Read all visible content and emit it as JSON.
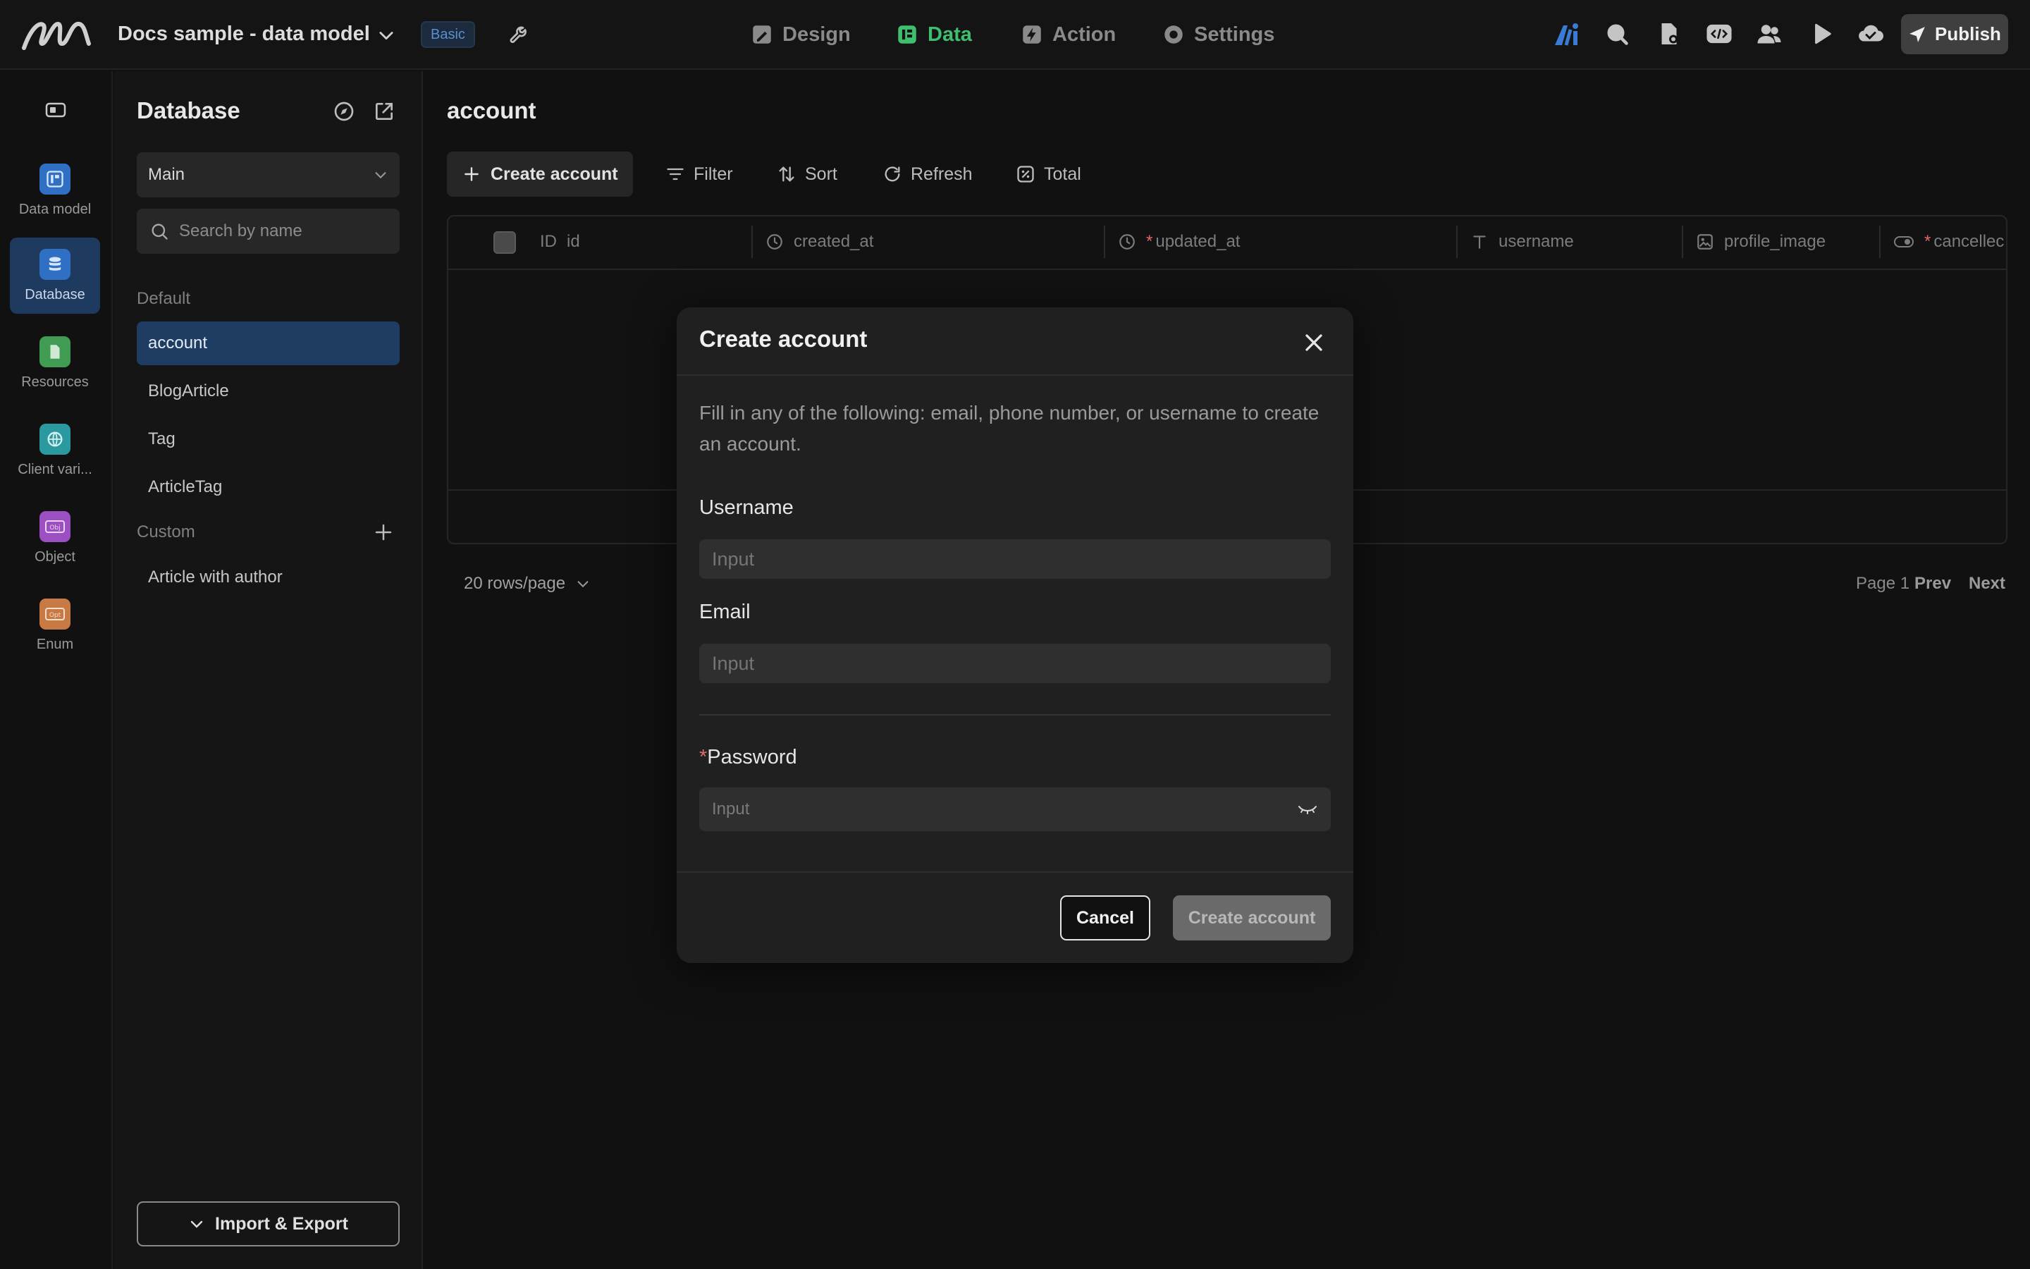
{
  "header": {
    "project_name": "Docs sample - data model",
    "plan_badge": "Basic",
    "tabs": [
      {
        "label": "Design",
        "icon": "pen-ruler-icon"
      },
      {
        "label": "Data",
        "icon": "table-icon"
      },
      {
        "label": "Action",
        "icon": "lightning-icon"
      },
      {
        "label": "Settings",
        "icon": "gear-icon"
      }
    ],
    "active_tab": "Data",
    "publish_label": "Publish"
  },
  "rail": {
    "items": [
      {
        "label": "Data model",
        "icon": "data-model-icon",
        "color": "#3b82f6"
      },
      {
        "label": "Database",
        "icon": "database-icon",
        "color": "#3b82f6"
      },
      {
        "label": "Resources",
        "icon": "file-icon",
        "color": "#4caf50"
      },
      {
        "label": "Client vari...",
        "icon": "globe-icon",
        "color": "#26a69a"
      },
      {
        "label": "Object",
        "icon": "object-icon",
        "color": "#ab47bc"
      },
      {
        "label": "Enum",
        "icon": "enum-icon",
        "color": "#e8834a"
      }
    ],
    "active": "Database"
  },
  "sidebar": {
    "title": "Database",
    "db_select_value": "Main",
    "search_placeholder": "Search by name",
    "default_section": "Default",
    "default_tables": [
      "account",
      "BlogArticle",
      "Tag",
      "ArticleTag"
    ],
    "active_table": "account",
    "custom_section": "Custom",
    "custom_tables": [
      "Article with author"
    ],
    "import_export_label": "Import & Export"
  },
  "main": {
    "title": "account",
    "toolbar": {
      "create_label": "Create account",
      "filter_label": "Filter",
      "sort_label": "Sort",
      "refresh_label": "Refresh",
      "total_label": "Total"
    },
    "columns": [
      {
        "prefix": "ID",
        "name": "id",
        "required": false
      },
      {
        "prefix": "",
        "name": "created_at",
        "required": false
      },
      {
        "prefix": "",
        "name": "updated_at",
        "required": true
      },
      {
        "prefix": "",
        "name": "username",
        "required": false
      },
      {
        "prefix": "",
        "name": "profile_image",
        "required": false
      },
      {
        "prefix": "",
        "name": "cancellec",
        "required": true
      }
    ],
    "rows_per_page": "20 rows/page",
    "page_label": "Page 1",
    "prev_label": "Prev",
    "next_label": "Next"
  },
  "modal": {
    "title": "Create account",
    "description": "Fill in any of the following: email, phone number, or username to create an account.",
    "username_label": "Username",
    "username_placeholder": "Input",
    "email_label": "Email",
    "email_placeholder": "Input",
    "password_required_mark": "*",
    "password_label": "Password",
    "password_placeholder": "Input",
    "cancel_label": "Cancel",
    "submit_label": "Create account"
  }
}
